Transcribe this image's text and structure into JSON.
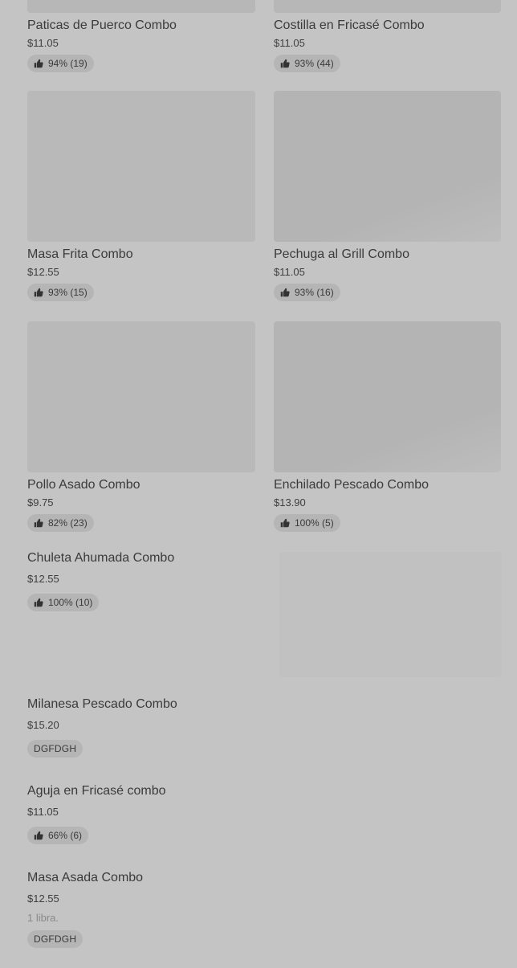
{
  "grid": [
    {
      "title": "Paticas de Puerco Combo",
      "price": "$11.05",
      "rating": "94% (19)"
    },
    {
      "title": "Costilla en Fricasé Combo",
      "price": "$11.05",
      "rating": "93% (44)"
    },
    {
      "title": "Masa Frita Combo",
      "price": "$12.55",
      "rating": "93% (15)"
    },
    {
      "title": "Pechuga al Grill Combo",
      "price": "$11.05",
      "rating": "93% (16)"
    },
    {
      "title": "Pollo Asado Combo",
      "price": "$9.75",
      "rating": "82% (23)"
    },
    {
      "title": "Enchilado Pescado Combo",
      "price": "$13.90",
      "rating": "100% (5)"
    }
  ],
  "list": [
    {
      "title": "Chuleta Ahumada Combo",
      "price": "$12.55",
      "rating": "100% (10)"
    },
    {
      "title": "Milanesa Pescado Combo",
      "price": "$15.20",
      "badge": "DGFDGH"
    },
    {
      "title": "Aguja en Fricasé combo",
      "price": "$11.05",
      "rating": "66% (6)"
    },
    {
      "title": "Masa Asada Combo",
      "price": "$12.55",
      "description": "1 libra.",
      "badge": "DGFDGH"
    }
  ],
  "icons": {
    "rating": "thumbs-up-icon"
  }
}
